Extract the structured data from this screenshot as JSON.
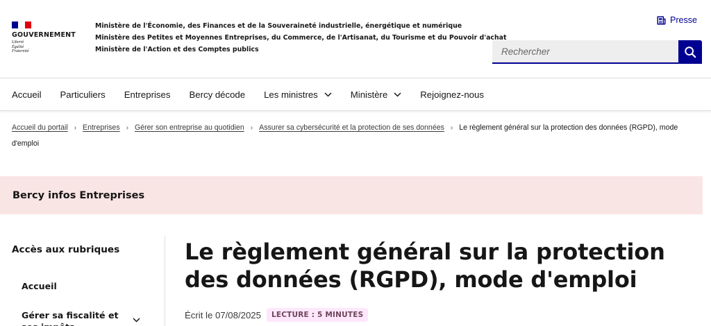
{
  "header": {
    "logo": {
      "title": "GOUVERNEMENT",
      "motto": [
        "Liberté",
        "Égalité",
        "Fraternité"
      ],
      "flag_colors": [
        "#000091",
        "#ffffff",
        "#e1000f"
      ]
    },
    "ministries": [
      "Ministère de l'Économie, des Finances et de la Souveraineté industrielle, énergétique et numérique",
      "Ministère des Petites et Moyennes Entreprises, du Commerce, de l'Artisanat, du Tourisme et du Pouvoir d'achat",
      "Ministère de l'Action et des Comptes publics"
    ],
    "presse_label": "Presse",
    "search": {
      "placeholder": "Rechercher",
      "value": ""
    }
  },
  "nav": {
    "items": [
      {
        "label": "Accueil"
      },
      {
        "label": "Particuliers"
      },
      {
        "label": "Entreprises"
      },
      {
        "label": "Bercy décode"
      },
      {
        "label": "Les ministres"
      },
      {
        "label": "Ministère"
      },
      {
        "label": "Rejoignez-nous"
      }
    ]
  },
  "breadcrumb": {
    "links": [
      "Accueil du portail",
      "Entreprises",
      "Gérer son entreprise au quotidien",
      "Assurer sa cybersécurité et la protection de ses données"
    ],
    "current": "Le règlement général sur la protection des données (RGPD), mode d'emploi"
  },
  "banner": {
    "title": "Bercy infos Entreprises"
  },
  "sidebar": {
    "title": "Accès aux rubriques",
    "items": [
      {
        "label": "Accueil"
      },
      {
        "label": "Gérer sa fiscalité et ses impôts"
      }
    ]
  },
  "article": {
    "title": "Le règlement général sur la protection des données (RGPD), mode d'emploi",
    "date": "Écrit le 07/08/2025",
    "reading_badge": "LECTURE : 5 MINUTES"
  },
  "colors": {
    "accent": "#000091",
    "banner_bg": "#fae5e5",
    "badge_bg": "#fee7fc",
    "badge_text": "#6e445a"
  }
}
